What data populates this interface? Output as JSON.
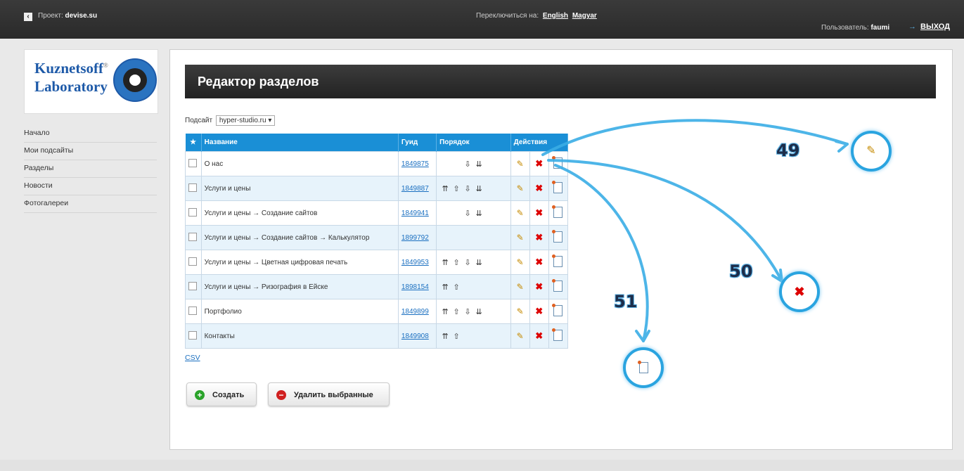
{
  "topbar": {
    "back_icon": "chevron-left-icon",
    "project_label": "Проект:",
    "project_name": "devise.su",
    "switch_label": "Переключиться на:",
    "lang_en": "English",
    "lang_hu": "Magyar",
    "user_label": "Пользователь:",
    "user_name": "faumi",
    "logout_label": "ВЫХОД"
  },
  "logo": {
    "line1": "Kuznetsoff",
    "line2": "Laboratory",
    "registered": "®"
  },
  "sidebar": {
    "items": [
      {
        "label": "Начало"
      },
      {
        "label": "Мои подсайты"
      },
      {
        "label": "Разделы"
      },
      {
        "label": "Новости"
      },
      {
        "label": "Фотогалереи"
      }
    ]
  },
  "main": {
    "title": "Редактор разделов",
    "subsite_label": "Подсайт",
    "subsite_value": "hyper-studio.ru",
    "table": {
      "headers": {
        "star": "★",
        "name": "Название",
        "guid": "Гуид",
        "order": "Порядок",
        "actions": "Действия"
      },
      "rows": [
        {
          "name": "О нас",
          "guid": "1849875",
          "order": [
            "",
            "",
            "⇩",
            "⇊"
          ]
        },
        {
          "name": "Услуги и цены",
          "guid": "1849887",
          "order": [
            "⇈",
            "⇧",
            "⇩",
            "⇊"
          ]
        },
        {
          "name": "Услуги и цены → Создание сайтов",
          "guid": "1849941",
          "order": [
            "",
            "",
            "⇩",
            "⇊"
          ]
        },
        {
          "name": "Услуги и цены → Создание сайтов → Калькулятор",
          "guid": "1899792",
          "order": [
            "",
            "",
            "",
            ""
          ]
        },
        {
          "name": "Услуги и цены → Цветная цифровая печать",
          "guid": "1849953",
          "order": [
            "⇈",
            "⇧",
            "⇩",
            "⇊"
          ]
        },
        {
          "name": "Услуги и цены → Ризография в Ейске",
          "guid": "1898154",
          "order": [
            "⇈",
            "⇧",
            "",
            ""
          ]
        },
        {
          "name": "Портфолио",
          "guid": "1849899",
          "order": [
            "⇈",
            "⇧",
            "⇩",
            "⇊"
          ]
        },
        {
          "name": "Контакты",
          "guid": "1849908",
          "order": [
            "⇈",
            "⇧",
            "",
            ""
          ]
        }
      ]
    },
    "csv_label": "CSV",
    "create_label": "Создать",
    "delete_selected_label": "Удалить выбранные"
  },
  "callouts": [
    {
      "number": "49",
      "icon": "pencil-icon"
    },
    {
      "number": "50",
      "icon": "delete-x-icon"
    },
    {
      "number": "51",
      "icon": "new-page-icon"
    }
  ],
  "colors": {
    "accent": "#1a8fd6",
    "header_dark": "#2a2a2a",
    "callout": "#2aa4e0",
    "delete_red": "#d00000"
  }
}
